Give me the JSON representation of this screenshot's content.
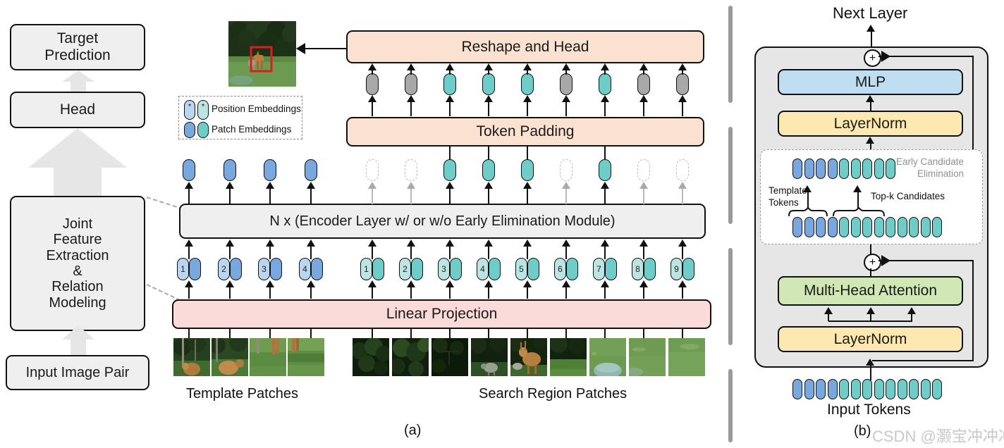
{
  "figure": {
    "caption_a": "(a)",
    "caption_b": "(b)",
    "watermark": "CSDN @灏宝冲冲冲"
  },
  "pipeline": {
    "target_prediction": "Target\nPrediction",
    "target_prediction_line1": "Target",
    "target_prediction_line2": "Prediction",
    "head": "Head",
    "joint_line1": "Joint",
    "joint_line2": "Feature",
    "joint_line3": "Extraction",
    "joint_line4": "&",
    "joint_line5": "Relation",
    "joint_line6": "Modeling",
    "input_image_pair": "Input Image Pair"
  },
  "legend": {
    "position_embeddings": "Position Embeddings",
    "patch_embeddings": "Patch Embeddings",
    "star_glyph": "*"
  },
  "panel_a": {
    "reshape_and_head": "Reshape and Head",
    "token_padding": "Token Padding",
    "encoder": "N x (Encoder Layer w/ or w/o Early Elimination Module)",
    "linear_projection": "Linear Projection",
    "template_patches_label": "Template Patches",
    "search_region_patches_label": "Search Region Patches",
    "template_token_numbers": [
      "1",
      "2",
      "3",
      "4"
    ],
    "search_token_numbers": [
      "1",
      "2",
      "3",
      "4",
      "5",
      "6",
      "7",
      "8",
      "9"
    ],
    "output_tokens": [
      "gray",
      "gray",
      "teal",
      "teal",
      "teal",
      "gray",
      "teal",
      "gray",
      "gray"
    ],
    "post_encoder_template_tokens": [
      "blue",
      "blue",
      "blue",
      "blue"
    ],
    "post_encoder_search_tokens": [
      "dashed",
      "dashed",
      "teal",
      "teal",
      "teal",
      "dashed",
      "teal",
      "dashed",
      "dashed"
    ]
  },
  "panel_b": {
    "next_layer": "Next Layer",
    "mlp": "MLP",
    "layernorm_top": "LayerNorm",
    "layernorm_bottom": "LayerNorm",
    "multi_head_attention": "Multi-Head Attention",
    "early_candidate_elimination_line1": "Early Candidate",
    "early_candidate_elimination_line2": "Elimination",
    "template_tokens_line1": "Template",
    "template_tokens_line2": "Tokens",
    "topk_candidates": "Top-k Candidates",
    "input_tokens": "Input Tokens",
    "plus_glyph": "+",
    "ece_out_template_count": 4,
    "ece_out_search_count": 5,
    "ece_in_template_count": 4,
    "ece_in_search_count": 9,
    "input_template_count": 4,
    "input_search_count": 9
  },
  "colors": {
    "position_blue": "#b9d5ef",
    "patch_blue": "#79a8de",
    "position_teal": "#bbe4e2",
    "patch_teal": "#6ecdc8",
    "gray_token": "#a8a8a8",
    "peach": "#fbe2d0",
    "pink": "#fbdada",
    "gray_block": "#efefef",
    "mlp_blue": "#bfdef2",
    "layernorm_yellow": "#fde9b0",
    "attention_green": "#cfe8b4",
    "bbox_red": "#e11b1b"
  }
}
